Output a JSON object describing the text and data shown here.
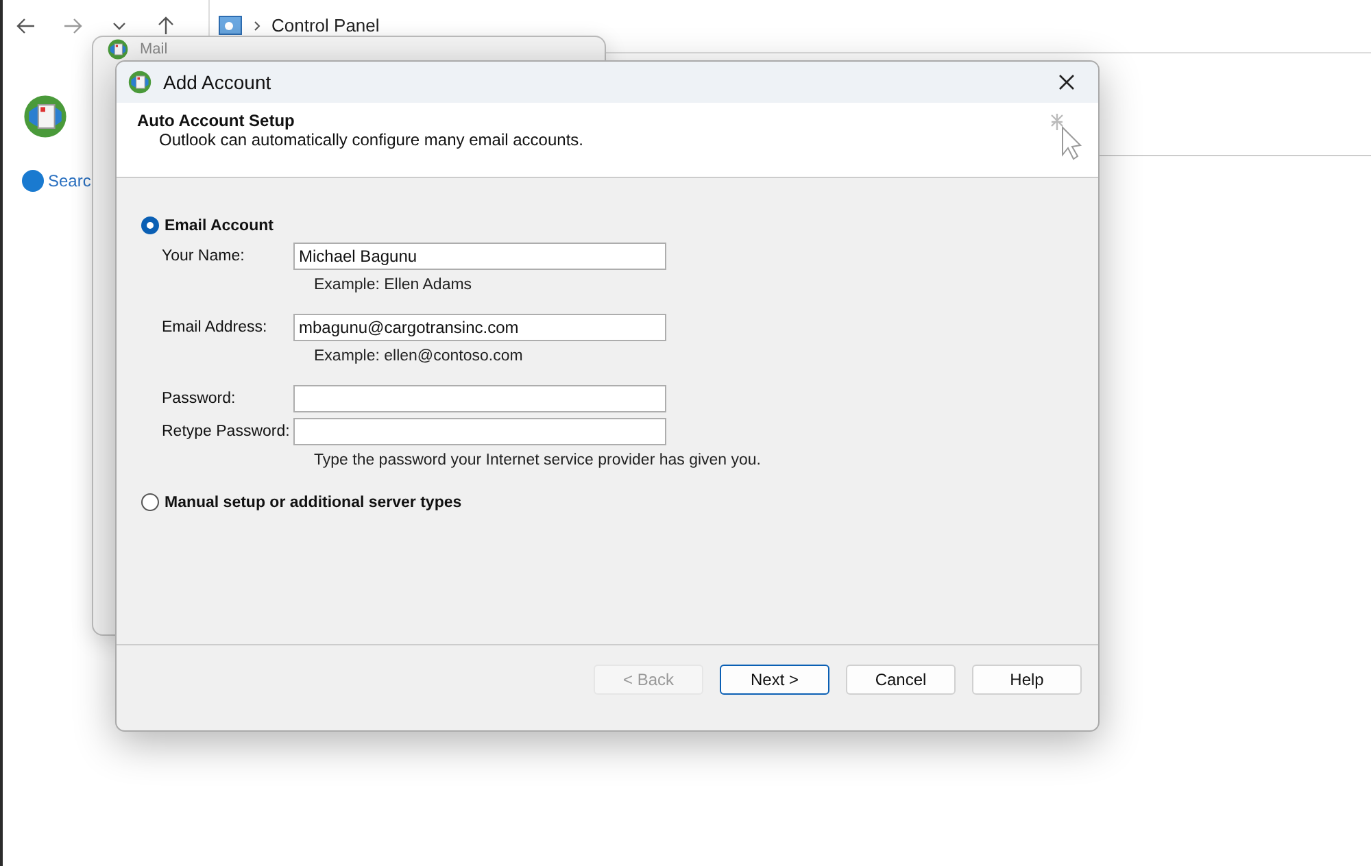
{
  "explorer": {
    "breadcrumb": "Control Panel",
    "search_link": "Searc"
  },
  "mail_window": {
    "title": "Mail"
  },
  "dialog": {
    "title": "Add Account",
    "header": {
      "title": "Auto Account Setup",
      "subtitle": "Outlook can automatically configure many email accounts."
    },
    "options": [
      {
        "label": "Email Account",
        "selected": true,
        "fields": [
          {
            "label": "Your Name:",
            "value": "Michael Bagunu",
            "hint": "Example: Ellen Adams"
          },
          {
            "label": "Email Address:",
            "value": "mbagunu@cargotransinc.com",
            "hint": "Example: ellen@contoso.com"
          },
          {
            "label": "Password:"
          },
          {
            "label": "Retype Password:",
            "hint": "Type the password your Internet service provider has given you."
          }
        ]
      },
      {
        "label": "Manual setup or additional server types",
        "selected": false
      }
    ],
    "buttons": [
      {
        "label": "< Back",
        "disabled": true,
        "default": false
      },
      {
        "label": "Next >",
        "disabled": false,
        "default": true
      },
      {
        "label": "Cancel",
        "disabled": false,
        "default": false
      },
      {
        "label": "Help",
        "disabled": false,
        "default": false
      }
    ]
  }
}
